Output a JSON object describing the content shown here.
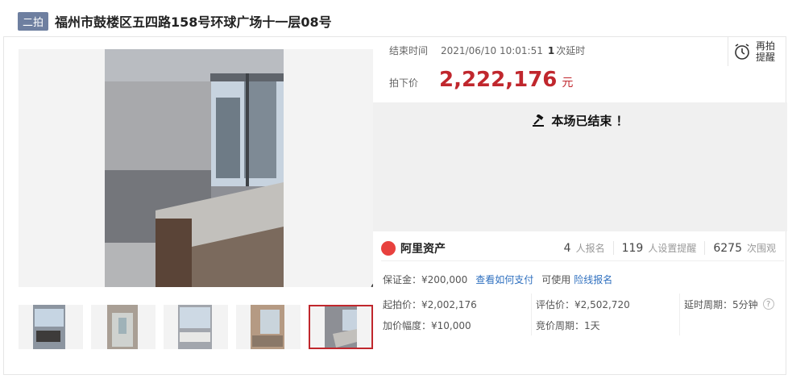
{
  "header": {
    "round_badge": "二拍",
    "title": "福州市鼓楼区五四路158号环球广场十一层08号"
  },
  "auction": {
    "end_time_label": "结束时间",
    "end_time_value": "2021/06/10 10:01:51",
    "delay_count": "1",
    "delay_text": "次延时",
    "remind_label_line1": "再拍",
    "remind_label_line2": "提醒",
    "final_price_label": "拍下价",
    "final_price": "2,222,176",
    "price_unit": "元",
    "ended_text": "本场已结束 ！"
  },
  "brand": {
    "name": "阿里资产"
  },
  "stats": [
    {
      "number": "4",
      "label": "人报名"
    },
    {
      "number": "119",
      "label": "人设置提醒"
    },
    {
      "number": "6275",
      "label": "次围观"
    }
  ],
  "deposit": {
    "label": "保证金：¥200,000",
    "how_to_pay_link": "查看如何支付",
    "usable_text": "可使用",
    "insurance_link": "险线报名"
  },
  "details": {
    "start_price": "起拍价：¥2,002,176",
    "appraisal": "评估价：¥2,502,720",
    "delay_period": "延时周期：5分钟",
    "increment": "加价幅度：¥10,000",
    "bid_period": "竞价周期：1天"
  },
  "images": {
    "main_photo": "office-room-photo",
    "thumbnails": [
      "office-photo-1",
      "office-photo-2",
      "office-photo-3",
      "office-photo-4",
      "office-photo-5"
    ],
    "selected_index": 4
  },
  "colors": {
    "accent_red": "#c0272d",
    "link_blue": "#2e6fbf",
    "badge_bg": "#6e7fa0",
    "ended_panel_bg": "#f0f0f0"
  }
}
